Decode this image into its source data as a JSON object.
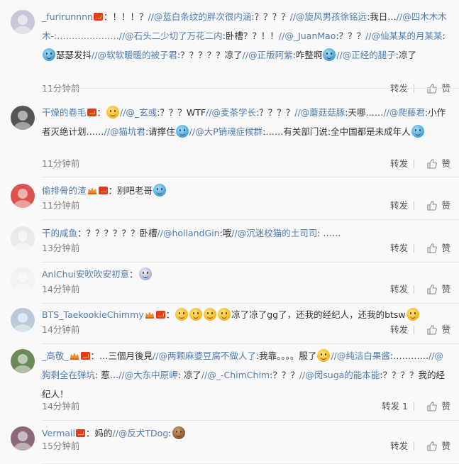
{
  "actions": {
    "forward": "转发",
    "like": "赞"
  },
  "comments": [
    {
      "user": "_furirunnnn",
      "avatar_color": "#c8c8d8",
      "time": "11分钟前",
      "forward": "转发",
      "parts": [
        [
          "plain",
          "："
        ],
        [
          "plain",
          "！！！？"
        ],
        [
          "mention",
          "//@蓝白条纹的胖次很内涵"
        ],
        [
          "plain",
          ":？？？？"
        ],
        [
          "mention",
          "//@旋风男孩徐铭远"
        ],
        [
          "plain",
          ":我日…"
        ],
        [
          "mention",
          "//@四木木木木-:…………………"
        ],
        [
          "mention",
          "//@石头二少切了万花二内"
        ],
        [
          "plain",
          ":卧槽？？！！"
        ],
        [
          "mention",
          "//@_JuanMao"
        ],
        [
          "plain",
          ":？？？"
        ],
        [
          "mention",
          "//@仙某某的月某某"
        ],
        [
          "plain",
          ":"
        ],
        [
          "emoji",
          "blue"
        ],
        [
          "plain",
          "瑟瑟发抖"
        ],
        [
          "mention",
          "//@软软暖暖的被子君"
        ],
        [
          "plain",
          ":？？？？？凉了"
        ],
        [
          "mention",
          "//@正版阿紫"
        ],
        [
          "plain",
          ":咋整啊"
        ],
        [
          "emoji",
          "blue"
        ],
        [
          "mention",
          "//@正经的腿子"
        ],
        [
          "plain",
          ":凉了"
        ]
      ]
    },
    {
      "user": "干燥的卷毛",
      "avatar_color": "#555",
      "time": "11分钟前",
      "forward": "转发",
      "parts": [
        [
          "plain",
          "："
        ],
        [
          "emoji",
          "yellow"
        ],
        [
          "mention",
          "//@_玄彧"
        ],
        [
          "plain",
          ":？？？WTF"
        ],
        [
          "mention",
          "//@麦茶学长"
        ],
        [
          "plain",
          ":？？？？"
        ],
        [
          "mention",
          "//@蘑菇菇豚"
        ],
        [
          "plain",
          ":天哪……"
        ],
        [
          "mention",
          "//@爬藤君"
        ],
        [
          "plain",
          ":小作者灭绝计划……"
        ],
        [
          "mention",
          "//@猫坑君"
        ],
        [
          "plain",
          ":请撑住"
        ],
        [
          "emoji",
          "blue"
        ],
        [
          "mention",
          "//@大P销魂症候群"
        ],
        [
          "plain",
          ":……有关部门说:全中国都是未成年人"
        ],
        [
          "emoji",
          "blue"
        ]
      ]
    },
    {
      "user": "偷排骨的渣",
      "avatar_color": "#d9534f",
      "time": "11分钟前",
      "forward": "转发",
      "parts": [
        [
          "plain",
          "：别吧老哥"
        ],
        [
          "emoji",
          "blue"
        ]
      ]
    },
    {
      "user": "干的咸鱼",
      "avatar_color": "#e9e9e9",
      "time": "13分钟前",
      "forward": "转发",
      "parts": [
        [
          "plain",
          "：？？？？？？卧槽"
        ],
        [
          "mention",
          "//@hollandGin"
        ],
        [
          "plain",
          ":哦"
        ],
        [
          "mention",
          "//@沉迷校猫的土司司"
        ],
        [
          "plain",
          ": ……"
        ]
      ]
    },
    {
      "user": "AnlChui安吹吹安初意",
      "avatar_color": "#f2f2f2",
      "time": "14分钟前",
      "forward": "转发",
      "parts": [
        [
          "plain",
          "："
        ],
        [
          "emoji",
          "dog"
        ]
      ]
    },
    {
      "user": "BTS_TaekookieChimmy",
      "avatar_color": "#b9c9d9",
      "time": "14分钟前",
      "forward": "转发",
      "parts": [
        [
          "plain",
          "："
        ],
        [
          "emoji",
          "yellow"
        ],
        [
          "emoji",
          "yellow"
        ],
        [
          "emoji",
          "yellow"
        ],
        [
          "emoji",
          "yellow"
        ],
        [
          "plain",
          "凉了凉了gg了，还我的经纪人，还我的btsw"
        ],
        [
          "emoji",
          "yellow"
        ]
      ]
    },
    {
      "user": "_高敬_",
      "avatar_color": "#6a8a5a",
      "time": "14分钟前",
      "forward": "转发 1",
      "parts": [
        [
          "plain",
          "：…三個月後見"
        ],
        [
          "mention",
          "//@两颗麻婆豆腐不做人了"
        ],
        [
          "plain",
          ":我靠。。。。服了"
        ],
        [
          "emoji",
          "yellow"
        ],
        [
          "mention",
          "//@纯洁白果酱"
        ],
        [
          "plain",
          ":…………"
        ],
        [
          "mention",
          "//@狗剩全在弹坑"
        ],
        [
          "plain",
          ": 惹…"
        ],
        [
          "mention",
          "//@大东中原岬"
        ],
        [
          "plain",
          ": 凉了"
        ],
        [
          "mention",
          "//@_-ChimChim"
        ],
        [
          "plain",
          ":？？？"
        ],
        [
          "mention",
          "//@闵suga的能本能"
        ],
        [
          "plain",
          ":？？？？我的经纪人！"
        ]
      ]
    },
    {
      "user": "Vermail",
      "avatar_color": "#8a6a7a",
      "time": "15分钟前",
      "forward": "转发",
      "parts": [
        [
          "plain",
          "：妈的"
        ],
        [
          "mention",
          "//@反犬TDog"
        ],
        [
          "plain",
          ":"
        ],
        [
          "emoji",
          "monkey"
        ]
      ]
    }
  ]
}
